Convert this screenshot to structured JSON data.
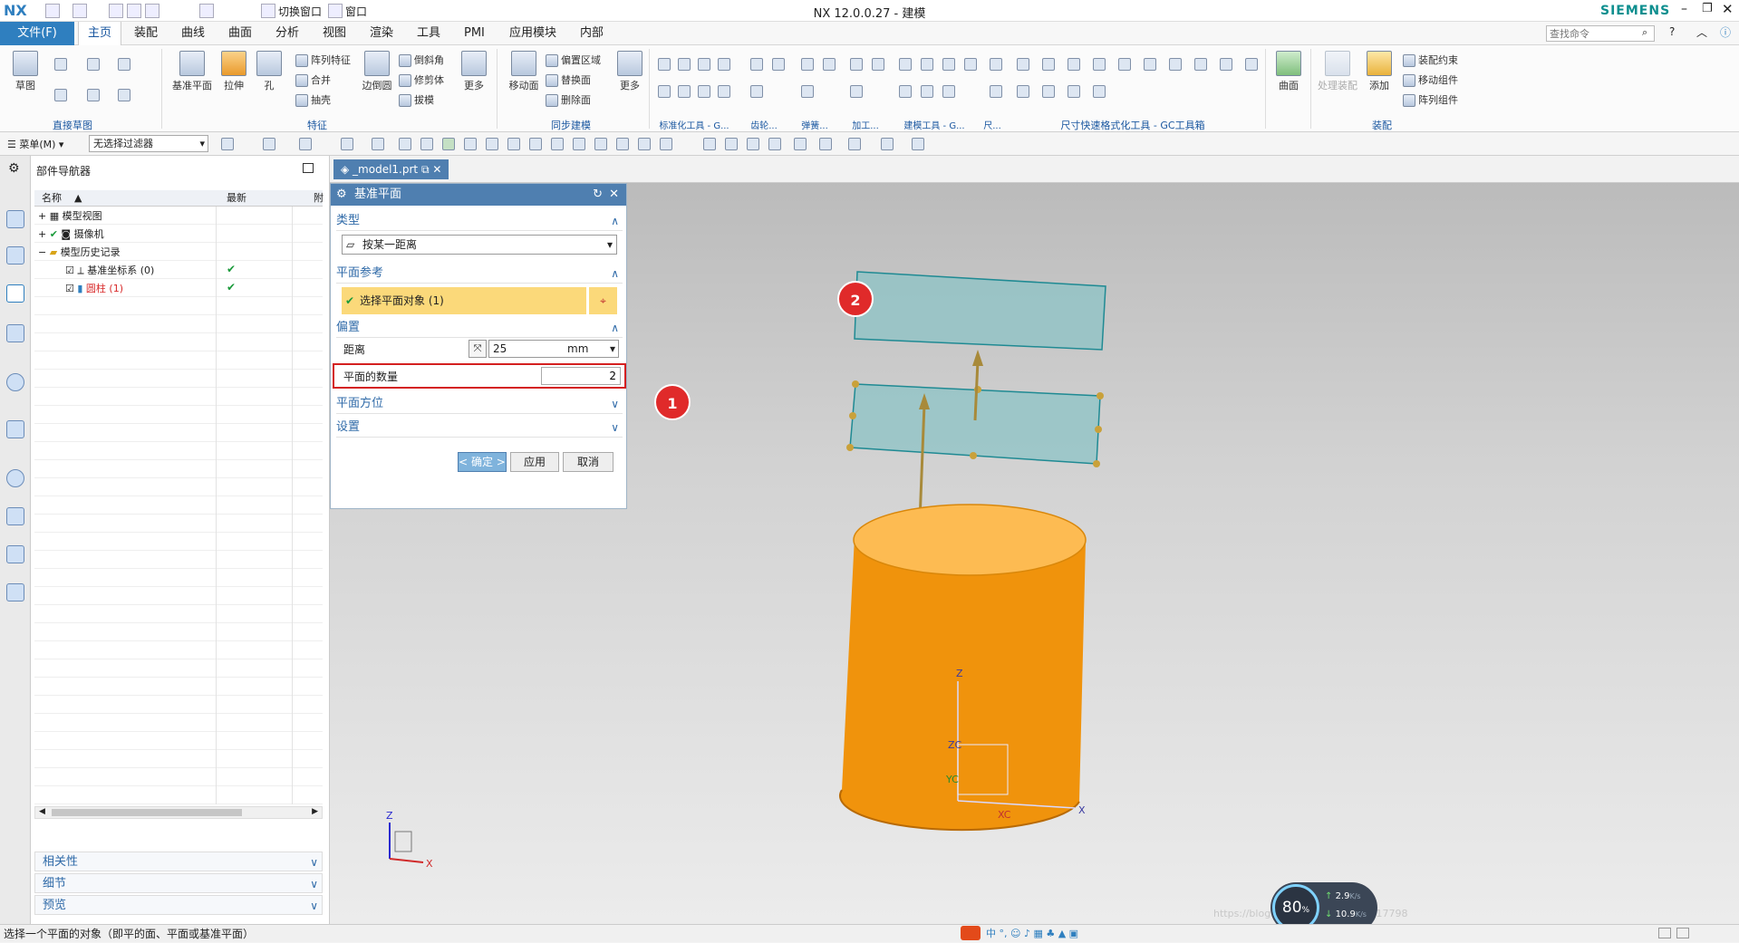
{
  "app": {
    "logo": "NX",
    "title": "NX 12.0.0.27 - 建模",
    "brand": "SIEMENS",
    "switch_window": "切换窗口",
    "window_menu": "窗口"
  },
  "menu_tabs": [
    "文件(F)",
    "主页",
    "装配",
    "曲线",
    "曲面",
    "分析",
    "视图",
    "渲染",
    "工具",
    "PMI",
    "应用模块",
    "内部"
  ],
  "search": {
    "placeholder": "查找命令"
  },
  "ribbon": {
    "sketch": "草图",
    "groups": [
      "直接草图",
      "特征",
      "同步建模",
      "标准化工具 - G...",
      "齿轮...",
      "弹簧...",
      "加工...",
      "建模工具 - G...",
      "尺...",
      "尺寸快速格式化工具 - GC工具箱",
      "装配"
    ],
    "big": [
      "基准平面",
      "拉伸",
      "孔",
      "边倒圆",
      "更多",
      "移动面",
      "更多",
      "曲面",
      "处理装配",
      "添加"
    ],
    "small": [
      "阵列特征",
      "合并",
      "抽壳",
      "倒斜角",
      "修剪体",
      "拔模",
      "偏置区域",
      "替换面",
      "删除面",
      "装配约束",
      "移动组件",
      "阵列组件"
    ]
  },
  "toolbar2": {
    "menu": "菜单(M)",
    "filter": "无选择过滤器"
  },
  "navigator": {
    "title": "部件导航器",
    "col_name": "名称",
    "col_latest": "最新",
    "col_extra": "附",
    "items": [
      {
        "label": "模型视图"
      },
      {
        "label": "摄像机"
      },
      {
        "label": "模型历史记录"
      },
      {
        "label": "基准坐标系 (0)",
        "check": "✔"
      },
      {
        "label": "圆柱 (1)",
        "check": "✔"
      }
    ],
    "panels": [
      "相关性",
      "细节",
      "预览"
    ]
  },
  "doc_tab": "_model1.prt",
  "dialog": {
    "title": "基准平面",
    "sec_type": "类型",
    "type_value": "按某一距离",
    "sec_ref": "平面参考",
    "select_obj": "选择平面对象 (1)",
    "sec_offset": "偏置",
    "distance_label": "距离",
    "distance_value": "25",
    "distance_unit": "mm",
    "count_label": "平面的数量",
    "count_value": "2",
    "sec_orient": "平面方位",
    "sec_settings": "设置",
    "ok": "< 确定 >",
    "apply": "应用",
    "cancel": "取消"
  },
  "callouts": [
    "1",
    "2"
  ],
  "axes": {
    "z": "Z",
    "x": "X",
    "zc": "ZC",
    "xc": "XC",
    "yc": "YC"
  },
  "status": "选择一个平面的对象（即平的面、平面或基准平面）",
  "perf": {
    "percent": "80",
    "unit": "%",
    "up": "2.9",
    "down": "10.9",
    "rate_unit": "K/s"
  },
  "watermark": "https://blog.csdn.net/weixin_40417798",
  "colors": {
    "accent": "#2f7fbf",
    "callout": "#e02a2a",
    "cylinder": "#f0930c",
    "plane": "#8cc3c6"
  }
}
